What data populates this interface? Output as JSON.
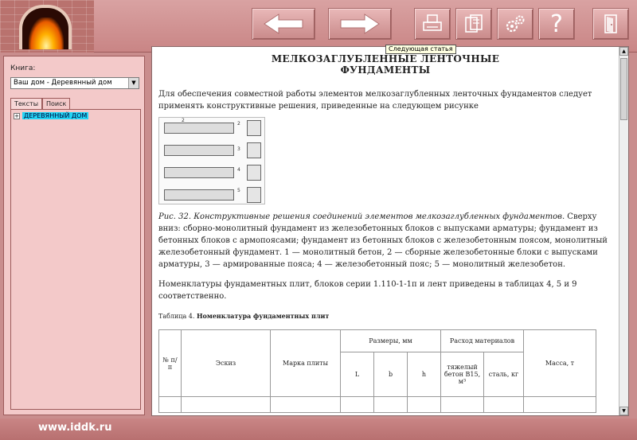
{
  "toolbar": {
    "back": "back",
    "forward": "forward",
    "print": "print",
    "copy": "copy",
    "settings": "settings",
    "help": "?",
    "exit": "exit",
    "tooltip": "Следующая статья"
  },
  "left_panel": {
    "book_label": "Книга:",
    "book_value": "Ваш дом - Деревянный дом",
    "tabs": [
      "Тексты",
      "Поиск"
    ],
    "tree_root": "ДЕРЕВЯННЫЙ ДОМ"
  },
  "document": {
    "title_line1": "МЕЛКОЗАГЛУБЛЕННЫЕ ЛЕНТОЧНЫЕ",
    "title_line2": "ФУНДАМЕНТЫ",
    "intro": "Для обеспечения совместной работы элементов мелкозаглубленных ленточных фундаментов следует применять конструктивные решения, приведенные на следующем рисунке",
    "figure_caption_italic": "Рис. 32. Конструктивные решения соединений элементов мелкозаглубленных фундаментов.",
    "figure_caption_rest": " Сверху вниз: сборно-монолитный фундамент из железобетонных блоков с выпусками арматуры; фундамент из бетонных блоков с армопоясами; фундамент из бетонных блоков с железобетонным поясом, монолитный железобетонный фундамент. 1 — монолитный бетон, 2 — сборные железобетонные блоки с выпусками арматуры, 3 — армированные пояса; 4 — железобетонный пояс; 5 — монолитный железобетон.",
    "nomenclature": "Номенклатуры фундаментных плит, блоков серии 1.110-1-1п и лент приведены в таблицах 4, 5 и 9 соответственно.",
    "table_caption_prefix": "Таблица 4. ",
    "table_caption_bold": "Номенклатура фундаментных плит",
    "table": {
      "col_num": "№ п/п",
      "col_sketch": "Эскиз",
      "col_mark": "Марка плиты",
      "col_dims": "Размеры, мм",
      "col_dim_l": "L",
      "col_dim_b": "b",
      "col_dim_h": "h",
      "col_materials": "Расход материалов",
      "col_concrete": "тяжелый бетон В15, м³",
      "col_steel": "сталь, кг",
      "col_mass": "Масса, т"
    }
  },
  "footer": {
    "url": "www.iddk.ru"
  }
}
